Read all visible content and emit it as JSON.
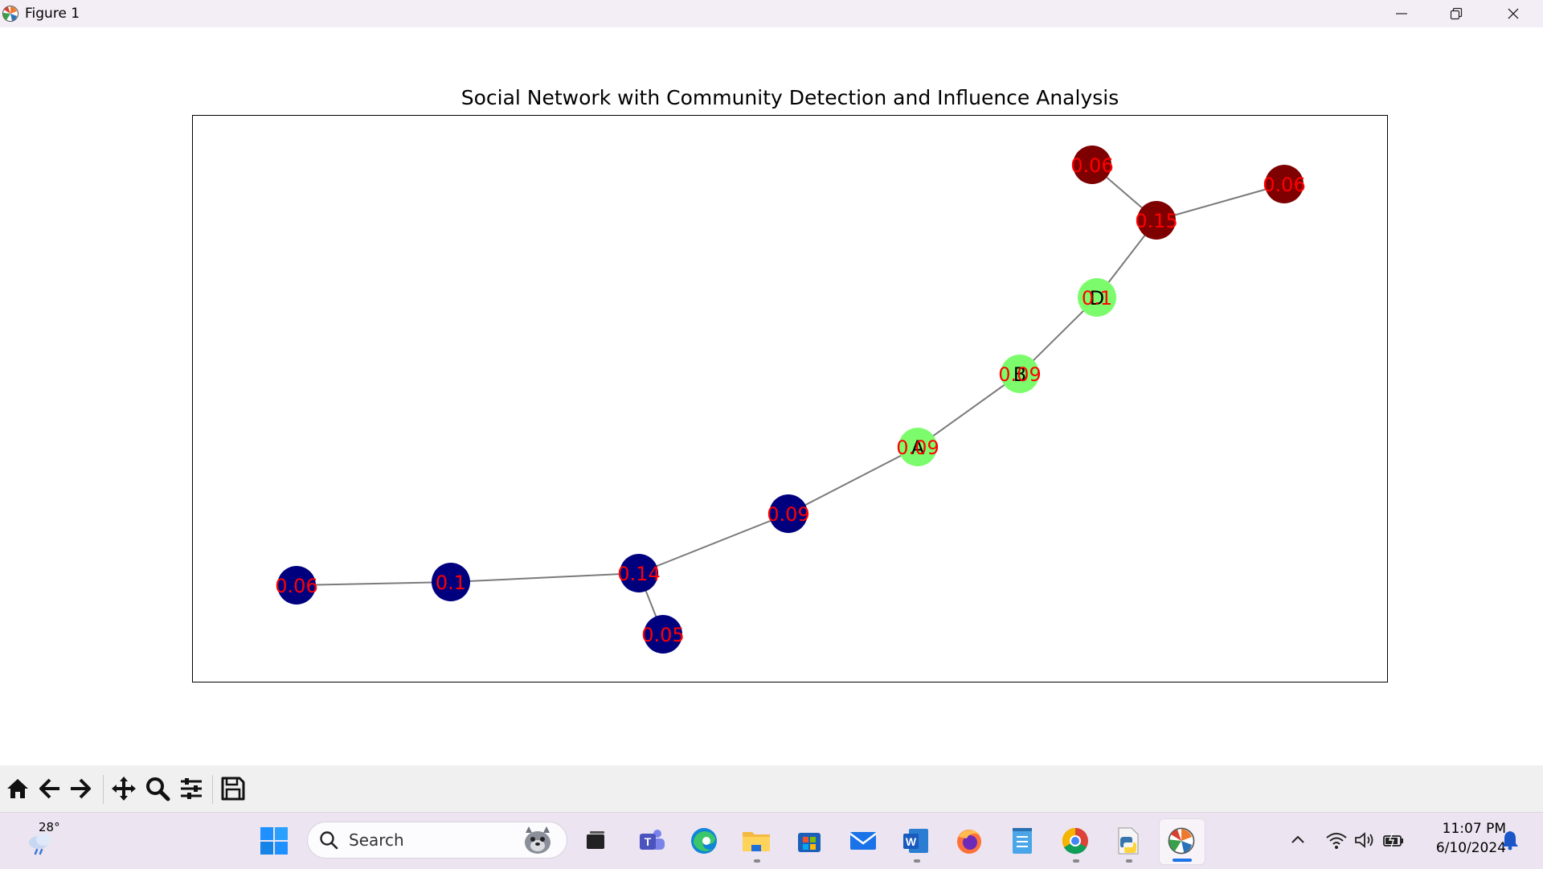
{
  "window": {
    "title": "Figure 1",
    "controls": [
      "minimize",
      "restore",
      "close"
    ]
  },
  "plot": {
    "title": "Social Network with Community Detection and Influence Analysis"
  },
  "chart_data": {
    "type": "network",
    "title": "Social Network with Community Detection and Influence Analysis",
    "axes_visible": false,
    "communities": [
      {
        "color": "#00007f"
      },
      {
        "color": "#7cfc6c"
      },
      {
        "color": "#7f0000"
      }
    ],
    "nodes": [
      {
        "id": "n1",
        "label": "",
        "community": 0,
        "influence": "0.06"
      },
      {
        "id": "n2",
        "label": "",
        "community": 0,
        "influence": "0.1"
      },
      {
        "id": "n3",
        "label": "",
        "community": 0,
        "influence": "0.14"
      },
      {
        "id": "n4",
        "label": "",
        "community": 0,
        "influence": "0.05"
      },
      {
        "id": "n5",
        "label": "",
        "community": 0,
        "influence": "0.09"
      },
      {
        "id": "A",
        "label": "A",
        "community": 1,
        "influence": "0.09"
      },
      {
        "id": "B",
        "label": "B",
        "community": 1,
        "influence": "0.09"
      },
      {
        "id": "D",
        "label": "D",
        "community": 1,
        "influence": "0.1"
      },
      {
        "id": "n9",
        "label": "",
        "community": 2,
        "influence": "0.15"
      },
      {
        "id": "n10",
        "label": "",
        "community": 2,
        "influence": "0.06"
      },
      {
        "id": "n11",
        "label": "",
        "community": 2,
        "influence": "0.06"
      }
    ],
    "edges": [
      [
        "n1",
        "n2"
      ],
      [
        "n2",
        "n3"
      ],
      [
        "n3",
        "n4"
      ],
      [
        "n3",
        "n5"
      ],
      [
        "n5",
        "A"
      ],
      [
        "A",
        "B"
      ],
      [
        "B",
        "D"
      ],
      [
        "D",
        "n9"
      ],
      [
        "n9",
        "n10"
      ],
      [
        "n9",
        "n11"
      ]
    ]
  },
  "toolbar": {
    "buttons": [
      "home-icon",
      "back-icon",
      "forward-icon",
      "pan-icon",
      "zoom-icon",
      "configure-subplots-icon",
      "save-icon"
    ]
  },
  "taskbar": {
    "weather_temp": "28°",
    "search_placeholder": "Search",
    "apps": [
      "start",
      "task-view",
      "teams",
      "edge",
      "file-explorer",
      "store",
      "mail",
      "word",
      "firefox",
      "notepad",
      "chrome",
      "python",
      "matplotlib"
    ],
    "time": "11:07 PM",
    "date": "6/10/2024"
  }
}
